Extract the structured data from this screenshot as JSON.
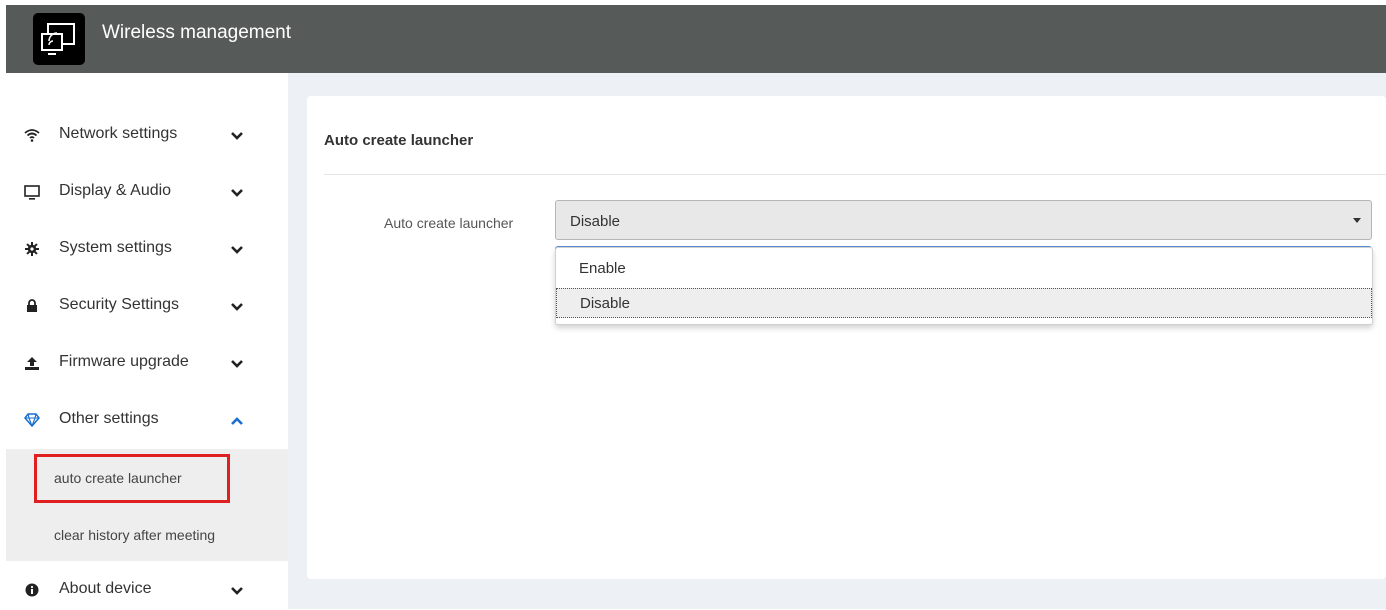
{
  "header": {
    "title": "Wireless management",
    "bg_color": "#565b5a"
  },
  "sidebar": {
    "items": [
      {
        "label": "Network settings",
        "icon": "wifi-icon",
        "expanded": false
      },
      {
        "label": "Display & Audio",
        "icon": "monitor-icon",
        "expanded": false
      },
      {
        "label": "System settings",
        "icon": "gear-icon",
        "expanded": false
      },
      {
        "label": "Security Settings",
        "icon": "lock-icon",
        "expanded": false
      },
      {
        "label": "Firmware upgrade",
        "icon": "upload-icon",
        "expanded": false
      },
      {
        "label": "Other settings",
        "icon": "diamond-icon",
        "expanded": true
      },
      {
        "label": "About device",
        "icon": "info-icon",
        "expanded": false
      }
    ],
    "subitems": [
      {
        "label": "auto create launcher",
        "highlighted": true
      },
      {
        "label": "clear history after meeting",
        "highlighted": false
      }
    ],
    "accent_color": "#1a6fd0",
    "highlight_color": "#e02020"
  },
  "main": {
    "card_title": "Auto create launcher",
    "field_label": "Auto create launcher",
    "select_value": "Disable",
    "options": [
      {
        "label": "Enable",
        "selected": false
      },
      {
        "label": "Disable",
        "selected": true
      }
    ]
  }
}
